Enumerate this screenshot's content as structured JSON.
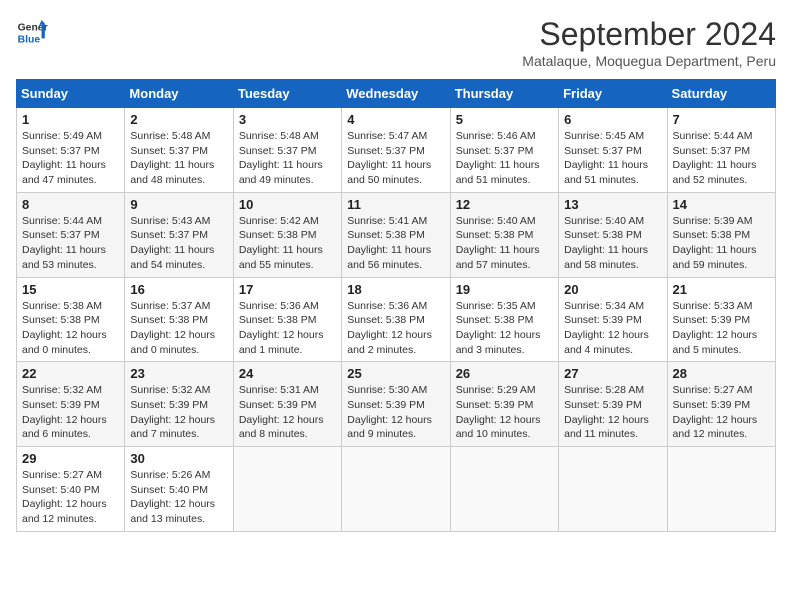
{
  "header": {
    "logo_line1": "General",
    "logo_line2": "Blue",
    "month": "September 2024",
    "location": "Matalaque, Moquegua Department, Peru"
  },
  "days_of_week": [
    "Sunday",
    "Monday",
    "Tuesday",
    "Wednesday",
    "Thursday",
    "Friday",
    "Saturday"
  ],
  "weeks": [
    [
      {
        "day": "1",
        "sunrise": "5:49 AM",
        "sunset": "5:37 PM",
        "daylight": "11 hours and 47 minutes."
      },
      {
        "day": "2",
        "sunrise": "5:48 AM",
        "sunset": "5:37 PM",
        "daylight": "11 hours and 48 minutes."
      },
      {
        "day": "3",
        "sunrise": "5:48 AM",
        "sunset": "5:37 PM",
        "daylight": "11 hours and 49 minutes."
      },
      {
        "day": "4",
        "sunrise": "5:47 AM",
        "sunset": "5:37 PM",
        "daylight": "11 hours and 50 minutes."
      },
      {
        "day": "5",
        "sunrise": "5:46 AM",
        "sunset": "5:37 PM",
        "daylight": "11 hours and 51 minutes."
      },
      {
        "day": "6",
        "sunrise": "5:45 AM",
        "sunset": "5:37 PM",
        "daylight": "11 hours and 51 minutes."
      },
      {
        "day": "7",
        "sunrise": "5:44 AM",
        "sunset": "5:37 PM",
        "daylight": "11 hours and 52 minutes."
      }
    ],
    [
      {
        "day": "8",
        "sunrise": "5:44 AM",
        "sunset": "5:37 PM",
        "daylight": "11 hours and 53 minutes."
      },
      {
        "day": "9",
        "sunrise": "5:43 AM",
        "sunset": "5:37 PM",
        "daylight": "11 hours and 54 minutes."
      },
      {
        "day": "10",
        "sunrise": "5:42 AM",
        "sunset": "5:38 PM",
        "daylight": "11 hours and 55 minutes."
      },
      {
        "day": "11",
        "sunrise": "5:41 AM",
        "sunset": "5:38 PM",
        "daylight": "11 hours and 56 minutes."
      },
      {
        "day": "12",
        "sunrise": "5:40 AM",
        "sunset": "5:38 PM",
        "daylight": "11 hours and 57 minutes."
      },
      {
        "day": "13",
        "sunrise": "5:40 AM",
        "sunset": "5:38 PM",
        "daylight": "11 hours and 58 minutes."
      },
      {
        "day": "14",
        "sunrise": "5:39 AM",
        "sunset": "5:38 PM",
        "daylight": "11 hours and 59 minutes."
      }
    ],
    [
      {
        "day": "15",
        "sunrise": "5:38 AM",
        "sunset": "5:38 PM",
        "daylight": "12 hours and 0 minutes."
      },
      {
        "day": "16",
        "sunrise": "5:37 AM",
        "sunset": "5:38 PM",
        "daylight": "12 hours and 0 minutes."
      },
      {
        "day": "17",
        "sunrise": "5:36 AM",
        "sunset": "5:38 PM",
        "daylight": "12 hours and 1 minute."
      },
      {
        "day": "18",
        "sunrise": "5:36 AM",
        "sunset": "5:38 PM",
        "daylight": "12 hours and 2 minutes."
      },
      {
        "day": "19",
        "sunrise": "5:35 AM",
        "sunset": "5:38 PM",
        "daylight": "12 hours and 3 minutes."
      },
      {
        "day": "20",
        "sunrise": "5:34 AM",
        "sunset": "5:39 PM",
        "daylight": "12 hours and 4 minutes."
      },
      {
        "day": "21",
        "sunrise": "5:33 AM",
        "sunset": "5:39 PM",
        "daylight": "12 hours and 5 minutes."
      }
    ],
    [
      {
        "day": "22",
        "sunrise": "5:32 AM",
        "sunset": "5:39 PM",
        "daylight": "12 hours and 6 minutes."
      },
      {
        "day": "23",
        "sunrise": "5:32 AM",
        "sunset": "5:39 PM",
        "daylight": "12 hours and 7 minutes."
      },
      {
        "day": "24",
        "sunrise": "5:31 AM",
        "sunset": "5:39 PM",
        "daylight": "12 hours and 8 minutes."
      },
      {
        "day": "25",
        "sunrise": "5:30 AM",
        "sunset": "5:39 PM",
        "daylight": "12 hours and 9 minutes."
      },
      {
        "day": "26",
        "sunrise": "5:29 AM",
        "sunset": "5:39 PM",
        "daylight": "12 hours and 10 minutes."
      },
      {
        "day": "27",
        "sunrise": "5:28 AM",
        "sunset": "5:39 PM",
        "daylight": "12 hours and 11 minutes."
      },
      {
        "day": "28",
        "sunrise": "5:27 AM",
        "sunset": "5:39 PM",
        "daylight": "12 hours and 12 minutes."
      }
    ],
    [
      {
        "day": "29",
        "sunrise": "5:27 AM",
        "sunset": "5:40 PM",
        "daylight": "12 hours and 12 minutes."
      },
      {
        "day": "30",
        "sunrise": "5:26 AM",
        "sunset": "5:40 PM",
        "daylight": "12 hours and 13 minutes."
      },
      null,
      null,
      null,
      null,
      null
    ]
  ]
}
